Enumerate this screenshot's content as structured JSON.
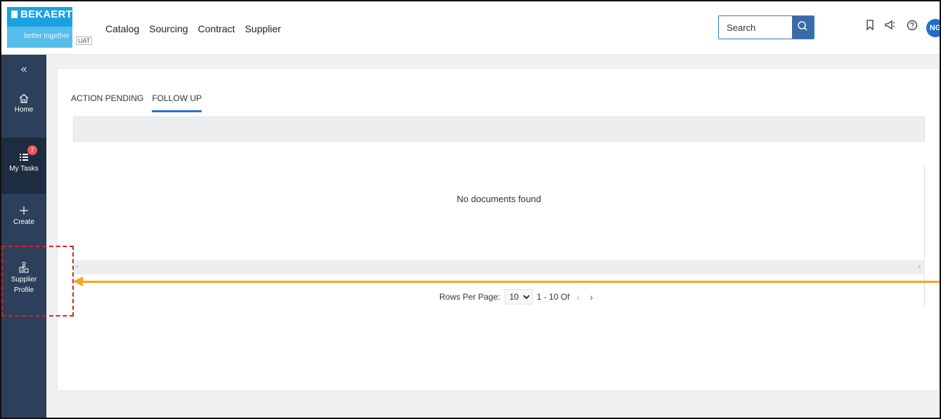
{
  "header": {
    "brand": "BEKAERT",
    "tagline": "better together",
    "env_badge": "UAT",
    "nav": [
      "Catalog",
      "Sourcing",
      "Contract",
      "Supplier"
    ],
    "search_placeholder": "Search",
    "avatar_initials": "NG"
  },
  "sidebar": {
    "items": [
      {
        "label": "Home",
        "icon": "home-icon"
      },
      {
        "label": "My Tasks",
        "icon": "tasks-icon",
        "badge": "7"
      },
      {
        "label": "Create",
        "icon": "plus-icon"
      },
      {
        "label_line1": "Supplier",
        "label_line2": "Profile",
        "icon": "supplier-profile-icon"
      }
    ]
  },
  "main": {
    "tabs": [
      "ACTION PENDING",
      "FOLLOW UP"
    ],
    "active_tab": "FOLLOW UP",
    "empty_message": "No documents found",
    "pagination": {
      "label": "Rows Per Page:",
      "rows_per_page": "10",
      "range": "1 - 10 Of"
    }
  },
  "colors": {
    "brand": "#1ba1e2",
    "sidebar": "#2c3f5b",
    "accent": "#2b6ed3",
    "annotation_box": "#e02020",
    "annotation_arrow": "#f5a623"
  }
}
